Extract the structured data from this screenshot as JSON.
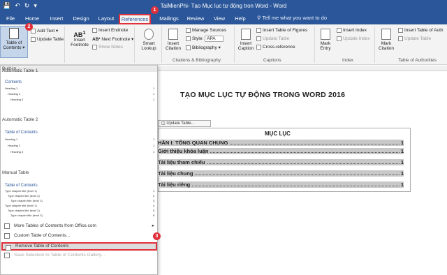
{
  "window": {
    "title": "TaiMienPhi- Tạo Mục lục tự động tron Word  -  Word",
    "qat_icons": [
      "save-icon",
      "undo-icon",
      "redo-icon",
      "customize-icon"
    ]
  },
  "tabs": [
    "File",
    "Home",
    "Insert",
    "Design",
    "Layout",
    "References",
    "Mailings",
    "Review",
    "View",
    "Help"
  ],
  "active_tab": "References",
  "tell_me": "Tell me what you want to do",
  "ribbon": {
    "toc_button": "Table of Contents",
    "add_text": "Add Text",
    "update_table": "Update Table",
    "footnote": "Insert Footnote",
    "insert_endnote": "Insert Endnote",
    "next_footnote": "Next Footnote",
    "show_notes": "Show Notes",
    "smart_lookup": "Smart Lookup",
    "insert_citation": "Insert Citation",
    "manage_sources": "Manage Sources",
    "style_label": "Style:",
    "style_value": "APA",
    "bibliography": "Bibliography",
    "insert_caption": "Insert Caption",
    "insert_table_figures": "Insert Table of Figures",
    "update_table_captions": "Update Table",
    "cross_reference": "Cross-reference",
    "mark_entry": "Mark Entry",
    "insert_index": "Insert Index",
    "update_index": "Update Index",
    "mark_citation": "Mark Citation",
    "insert_table_authorities": "Insert Table of Auth",
    "update_table_authorities": "Update Table",
    "groups": {
      "citations": "Citations & Bibliography",
      "captions": "Captions",
      "index": "Index",
      "authorities": "Table of Authorities"
    }
  },
  "callouts": [
    "1",
    "2",
    "3"
  ],
  "dropdown": {
    "built_in": "Built-In",
    "auto1": {
      "name": "Automatic Table 1",
      "title": "Contents",
      "lines": [
        {
          "text": "Heading 1",
          "num": "1"
        },
        {
          "text": "Heading 2",
          "num": "1"
        },
        {
          "text": "Heading 3",
          "num": "1"
        }
      ]
    },
    "auto2": {
      "name": "Automatic Table 2",
      "title": "Table of Contents",
      "lines": [
        {
          "text": "Heading 1",
          "num": "1"
        },
        {
          "text": "Heading 2",
          "num": "1"
        },
        {
          "text": "Heading 3",
          "num": "1"
        }
      ]
    },
    "manual": {
      "name": "Manual Table",
      "title": "Table of Contents",
      "lines": [
        {
          "text": "Type chapter title (level 1)",
          "num": "1"
        },
        {
          "text": "Type chapter title (level 2)",
          "num": "2"
        },
        {
          "text": "Type chapter title (level 3)",
          "num": "3"
        },
        {
          "text": "Type chapter title (level 1)",
          "num": "4"
        },
        {
          "text": "Type chapter title (level 2)",
          "num": "5"
        },
        {
          "text": "Type chapter title (level 3)",
          "num": "6"
        }
      ]
    },
    "menu": [
      "More Tables of Contents from Office.com",
      "Custom Table of Contents...",
      "Remove Table of Contents",
      "Save Selection to Table of Contents Gallery..."
    ]
  },
  "document": {
    "heading": "TẠO MỤC LỤC TỰ ĐỘNG TRONG WORD 2016",
    "update_table": "Update Table...",
    "toc_heading": "MỤC LỤC",
    "toc_rows": [
      {
        "label": "HẦN I: TỔNG QUAN CHUNG",
        "page": "1"
      },
      {
        "label": "Giới thiệu khóa luận",
        "page": "1"
      },
      {
        "label": "Tài liệu tham chiếu",
        "page": "1"
      },
      {
        "label": "Tài liệu chung",
        "page": "1"
      },
      {
        "label": "Tài liệu riêng",
        "page": "1"
      }
    ]
  }
}
